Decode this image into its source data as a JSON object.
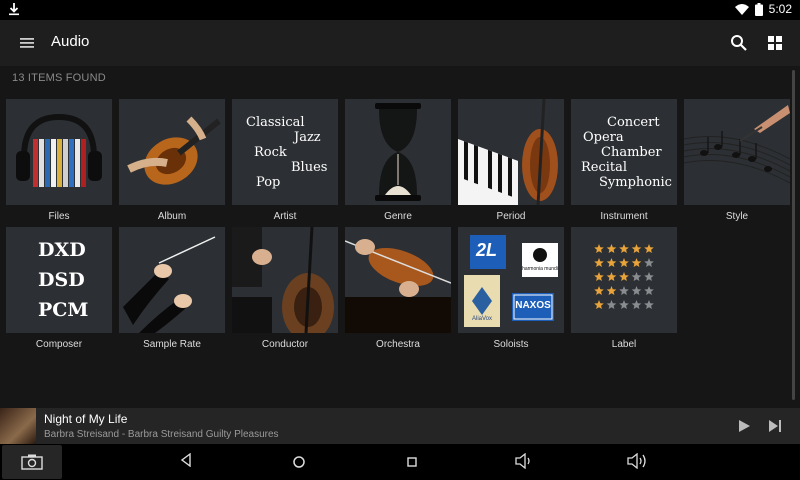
{
  "status": {
    "clock": "5:02"
  },
  "app": {
    "title": "Audio"
  },
  "list": {
    "count_text": "13 ITEMS FOUND"
  },
  "tiles": [
    {
      "label": "Files"
    },
    {
      "label": "Album"
    },
    {
      "label": "Artist",
      "words": [
        "Classical",
        "Jazz",
        "Rock",
        "Blues",
        "Pop"
      ]
    },
    {
      "label": "Genre"
    },
    {
      "label": "Period"
    },
    {
      "label": "Instrument",
      "words": [
        "Concert",
        "Opera",
        "Chamber",
        "Recital",
        "Symphonic"
      ]
    },
    {
      "label": "Style"
    },
    {
      "label": "Composer",
      "words": [
        "DXD",
        "DSD",
        "PCM"
      ]
    },
    {
      "label": "Sample Rate"
    },
    {
      "label": "Conductor"
    },
    {
      "label": "Orchestra"
    },
    {
      "label": "Soloists",
      "logos": [
        "2L",
        "harmonia mundi",
        "AliaVox",
        "NAXOS"
      ]
    },
    {
      "label": "Label"
    }
  ],
  "now_playing": {
    "title": "Night of My Life",
    "subtitle": "Barbra Streisand - Barbra Streisand Guilty Pleasures"
  },
  "colors": {
    "accent_star": "#e8a33a",
    "appbar": "#1e1e1e",
    "background": "#161616"
  }
}
